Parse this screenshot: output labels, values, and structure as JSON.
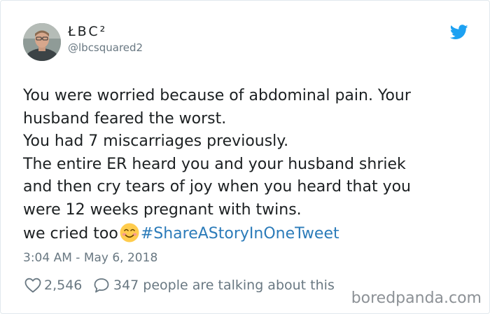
{
  "tweet": {
    "author": {
      "display_name": "ŁBC²",
      "handle": "@lbcsquared2",
      "avatar_icon": "avatar-photo"
    },
    "platform_icon": "twitter-bird-icon",
    "text_lines": [
      "You were worried because of abdominal pain. Your",
      "husband feared the worst.",
      "You had 7 miscarriages previously.",
      "The entire ER heard you and your husband shriek",
      "and then cry tears of joy when you heard that you",
      "were 12 weeks pregnant with twins."
    ],
    "last_line_text": "we cried too",
    "emoji_icon": "smiling-face-with-heart-eyes-icon",
    "hashtag": "#ShareAStoryInOneTweet",
    "timestamp": "3:04 AM - May 6, 2018",
    "likes": "2,546",
    "reply_text": "347 people are talking about this",
    "colors": {
      "text": "#1c2022",
      "muted": "#697882",
      "link": "#2b7bb9",
      "twitter_blue": "#1da1f2"
    }
  },
  "watermark": "boredpanda.com"
}
